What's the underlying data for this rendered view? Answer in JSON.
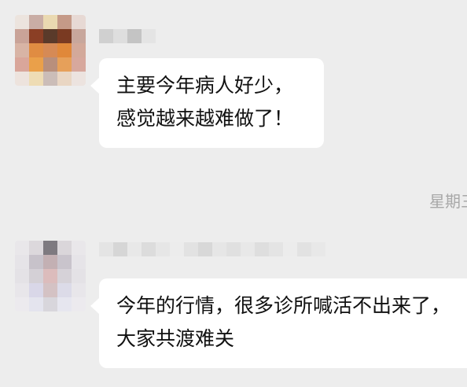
{
  "messages": [
    {
      "lines": [
        "主要今年病人好少，",
        "感觉越来越难做了！"
      ]
    },
    {
      "lines": [
        "今年的行情，很多诊所喊活不出来了，",
        "大家共渡难关"
      ]
    }
  ],
  "timestamp": "星期三",
  "avatars": {
    "first": [
      "#ece4de",
      "#c9ada5",
      "#ead9b1",
      "#c59a88",
      "#e7d9d4",
      "#c9a398",
      "#8b3f25",
      "#5a3a2a",
      "#7a3a22",
      "#c8a79c",
      "#d8b4a5",
      "#e08c42",
      "#d68a55",
      "#e0883a",
      "#d3a99a",
      "#d9a69a",
      "#eaa04a",
      "#b88f7c",
      "#e6a05a",
      "#d7a89d",
      "#ede3dd",
      "#eedcb4",
      "#cbbdb8",
      "#e9d6c3",
      "#ece3df"
    ],
    "second": [
      "#e9e7ea",
      "#dcd8dc",
      "#7e7a80",
      "#dad6da",
      "#e9e7ea",
      "#e6e4e8",
      "#c7c2ca",
      "#c3b0b3",
      "#c9c4cc",
      "#e6e4e8",
      "#e4e2e6",
      "#d4d0d6",
      "#dcbcbc",
      "#d6d2d8",
      "#e4e2e6",
      "#e8e6ea",
      "#d9d7e8",
      "#d4c2c4",
      "#dcdbe8",
      "#e8e6ea",
      "#eceaee",
      "#e4e4ee",
      "#d8d6dc",
      "#e6e6ef",
      "#eceaee"
    ]
  },
  "nicknames": {
    "first": [
      "#d0d0d0",
      "#dedede",
      "#c4c4c4",
      "#e4e4e4"
    ],
    "second": [
      "#e4e4e4",
      "#d6d6d6",
      "#e8e8e8",
      "#dcdcdc",
      "#e6e6e6",
      "#ececec",
      "#e2e2e2",
      "#d8d8d8",
      "#e6e6e6",
      "#e0e0e0",
      "#e8e8e8",
      "#dedede",
      "#e4e4e4",
      "#ececec",
      "#e2e2e2",
      "#e8e8e8"
    ]
  }
}
